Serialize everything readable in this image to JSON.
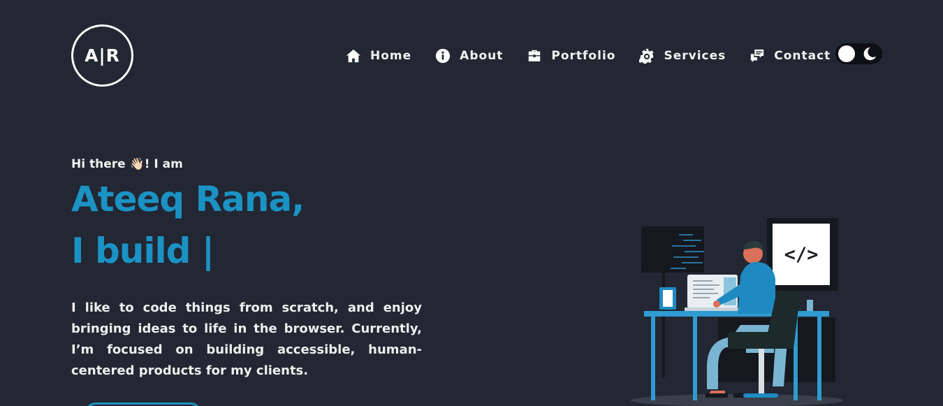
{
  "logo": {
    "text": "A|R"
  },
  "nav": {
    "items": [
      {
        "label": "Home",
        "icon": "home-icon"
      },
      {
        "label": "About",
        "icon": "info-icon"
      },
      {
        "label": "Portfolio",
        "icon": "briefcase-icon"
      },
      {
        "label": "Services",
        "icon": "gear-icon"
      },
      {
        "label": "Contact",
        "icon": "chat-icon"
      }
    ],
    "theme_toggle": {
      "state": "dark"
    }
  },
  "hero": {
    "greeting": "Hi there 👋🏻! I am",
    "name": "Ateeq Rana,",
    "typing": "I build |",
    "bio": "I like to code things from scratch, and enjoy bringing ideas to life in the browser. Currently, I’m focused on building accessible, human-centered products for my clients.",
    "illustration": {
      "screen_code": "</>"
    }
  },
  "colors": {
    "background": "#222733",
    "accent": "#1b92c4",
    "text": "#eeeeee"
  }
}
